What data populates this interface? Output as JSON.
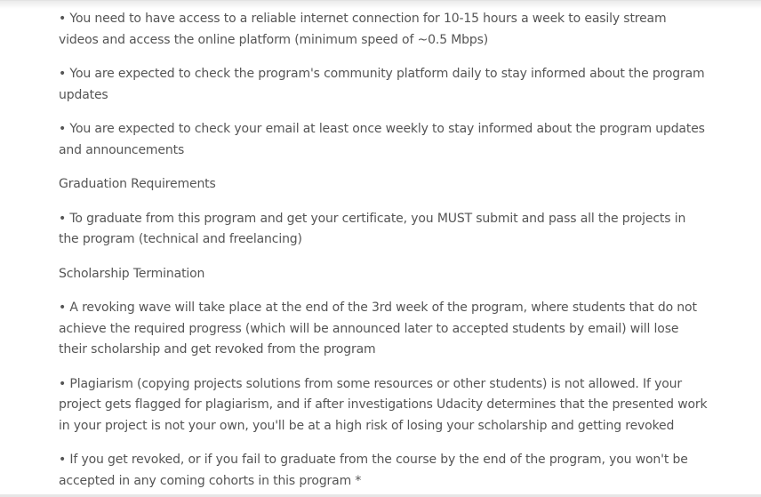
{
  "paragraphs": [
    {
      "id": "internet",
      "text": "• You need to have access to a reliable internet connection for 10-15 hours a week to easily stream videos and access the online platform (minimum speed of ~0.5 Mbps)"
    },
    {
      "id": "community",
      "text": "• You are expected to check the program's community platform daily to stay informed about the program updates"
    },
    {
      "id": "email",
      "text": "• You are expected to check your email at least once weekly to stay informed about the program updates and announcements"
    },
    {
      "id": "graduation-heading",
      "text": "Graduation Requirements"
    },
    {
      "id": "graduation",
      "text": "• To graduate from this program and get your certificate, you MUST submit and pass all the projects in the program (technical and freelancing)"
    },
    {
      "id": "termination-heading",
      "text": "Scholarship Termination"
    },
    {
      "id": "revoking",
      "text": "• A revoking wave will take place at the end of the 3rd week of the program, where students that do not achieve the required progress (which will be announced later to accepted students by email) will lose their scholarship and get revoked from the program"
    },
    {
      "id": "plagiarism",
      "text": "• Plagiarism (copying projects solutions from some resources or other students) is not allowed. If your project gets flagged for plagiarism, and if after investigations Udacity determines that the presented work in your project is not your own, you'll be at a high risk of losing your scholarship and getting revoked"
    },
    {
      "id": "fail",
      "text": "• If you get revoked, or if you fail to graduate from the course by the end of the program, you won't be accepted in any coming cohorts in this program *"
    }
  ]
}
